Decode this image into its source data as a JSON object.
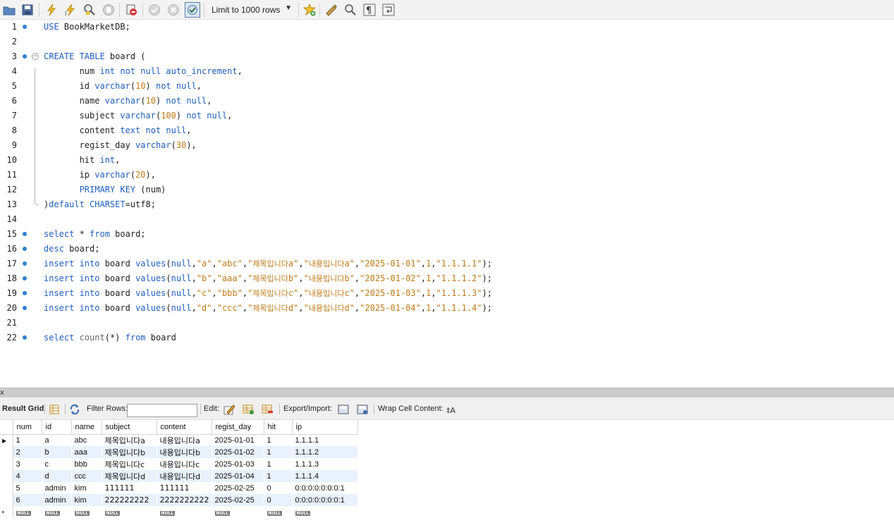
{
  "toolbar": {
    "limit_label": "Limit to 1000 rows",
    "icons": [
      "open-folder-icon",
      "save-icon",
      "execute-icon",
      "execute-current-icon",
      "explain-icon",
      "stop-icon",
      "toggle-error-stop-icon",
      "commit-icon",
      "rollback-icon",
      "autocommit-icon",
      "limit-rows-select",
      "add-snippet-icon",
      "beautify-icon",
      "find-icon",
      "invisible-chars-icon",
      "wrap-icon"
    ]
  },
  "editor": {
    "lines": [
      {
        "n": "1",
        "marker": "dot",
        "html": "<span class='kw'>USE</span> BookMarketDB;"
      },
      {
        "n": "2",
        "marker": "",
        "html": ""
      },
      {
        "n": "3",
        "marker": "dot-fold",
        "html": "<span class='kw'>CREATE TABLE</span> board ("
      },
      {
        "n": "4",
        "marker": "",
        "html": "       num <span class='kw'>int not null auto_increment</span>,"
      },
      {
        "n": "5",
        "marker": "",
        "html": "       id <span class='kw'>varchar</span>(<span class='num'>10</span>) <span class='kw'>not null</span>,"
      },
      {
        "n": "6",
        "marker": "",
        "html": "       name <span class='kw'>varchar</span>(<span class='num'>10</span>) <span class='kw'>not null</span>,"
      },
      {
        "n": "7",
        "marker": "",
        "html": "       subject <span class='kw'>varchar</span>(<span class='num'>100</span>) <span class='kw'>not null</span>,"
      },
      {
        "n": "8",
        "marker": "",
        "html": "       content <span class='kw'>text not null</span>,"
      },
      {
        "n": "9",
        "marker": "",
        "html": "       regist_day <span class='kw'>varchar</span>(<span class='num'>30</span>),"
      },
      {
        "n": "10",
        "marker": "",
        "html": "       hit <span class='kw'>int</span>,"
      },
      {
        "n": "11",
        "marker": "",
        "html": "       ip <span class='kw'>varchar</span>(<span class='num'>20</span>),"
      },
      {
        "n": "12",
        "marker": "",
        "html": "       <span class='kw'>PRIMARY KEY</span> (num)"
      },
      {
        "n": "13",
        "marker": "",
        "html": ")<span class='kw'>default CHARSET</span>=utf8;"
      },
      {
        "n": "14",
        "marker": "",
        "html": ""
      },
      {
        "n": "15",
        "marker": "dot",
        "html": "<span class='kw'>select</span> * <span class='kw'>from</span> board;"
      },
      {
        "n": "16",
        "marker": "dot",
        "html": "<span class='kw'>desc</span> board;"
      },
      {
        "n": "17",
        "marker": "dot",
        "html": "<span class='kw'>insert into</span> board <span class='kw'>values</span>(<span class='kw'>null</span>,<span class='str'>\"a\"</span>,<span class='str'>\"abc\"</span>,<span class='str'>\"<span class='ko'>제목입니다</span>a\"</span>,<span class='str'>\"<span class='ko'>내용입니다</span>a\"</span>,<span class='str'>\"2025-01-01\"</span>,<span class='num'>1</span>,<span class='str'>\"1.1.1.1\"</span>);"
      },
      {
        "n": "18",
        "marker": "dot",
        "html": "<span class='kw'>insert into</span> board <span class='kw'>values</span>(<span class='kw'>null</span>,<span class='str'>\"b\"</span>,<span class='str'>\"aaa\"</span>,<span class='str'>\"<span class='ko'>제목입니다</span>b\"</span>,<span class='str'>\"<span class='ko'>내용입니다</span>b\"</span>,<span class='str'>\"2025-01-02\"</span>,<span class='num'>1</span>,<span class='str'>\"1.1.1.2\"</span>);"
      },
      {
        "n": "19",
        "marker": "dot",
        "html": "<span class='kw'>insert into</span> board <span class='kw'>values</span>(<span class='kw'>null</span>,<span class='str'>\"c\"</span>,<span class='str'>\"bbb\"</span>,<span class='str'>\"<span class='ko'>제목입니다</span>c\"</span>,<span class='str'>\"<span class='ko'>내용입니다</span>c\"</span>,<span class='str'>\"2025-01-03\"</span>,<span class='num'>1</span>,<span class='str'>\"1.1.1.3\"</span>);"
      },
      {
        "n": "20",
        "marker": "dot",
        "html": "<span class='kw'>insert into</span> board <span class='kw'>values</span>(<span class='kw'>null</span>,<span class='str'>\"d\"</span>,<span class='str'>\"ccc\"</span>,<span class='str'>\"<span class='ko'>제목입니다</span>d\"</span>,<span class='str'>\"<span class='ko'>내용입니다</span>d\"</span>,<span class='str'>\"2025-01-04\"</span>,<span class='num'>1</span>,<span class='str'>\"1.1.1.4\"</span>);"
      },
      {
        "n": "21",
        "marker": "",
        "html": ""
      },
      {
        "n": "22",
        "marker": "dot",
        "html": "<span class='kw'>select</span> <span class='fn'>count</span>(*) <span class='kw'>from</span> board"
      }
    ]
  },
  "splitter": {
    "close_label": "x"
  },
  "result_toolbar": {
    "result_grid_label": "Result Grid",
    "filter_label": "Filter Rows:",
    "filter_value": "",
    "edit_label": "Edit:",
    "export_label": "Export/Import:",
    "wrap_label": "Wrap Cell Content:"
  },
  "result_grid": {
    "columns": [
      "num",
      "id",
      "name",
      "subject",
      "content",
      "regist_day",
      "hit",
      "ip"
    ],
    "rows": [
      [
        "1",
        "a",
        "abc",
        "제목입니다a",
        "내용입니다a",
        "2025-01-01",
        "1",
        "1.1.1.1"
      ],
      [
        "2",
        "b",
        "aaa",
        "제목입니다b",
        "내용입니다b",
        "2025-01-02",
        "1",
        "1.1.1.2"
      ],
      [
        "3",
        "c",
        "bbb",
        "제목입니다c",
        "내용입니다c",
        "2025-01-03",
        "1",
        "1.1.1.3"
      ],
      [
        "4",
        "d",
        "ccc",
        "제목입니다d",
        "내용입니다d",
        "2025-01-04",
        "1",
        "1.1.1.4"
      ],
      [
        "5",
        "admin",
        "kim",
        "111111",
        "111111",
        "2025-02-25",
        "0",
        "0:0:0:0:0:0:0:1"
      ],
      [
        "6",
        "admin",
        "kim",
        "222222222",
        "2222222222",
        "2025-02-25",
        "0",
        "0:0:0:0:0:0:0:1"
      ]
    ],
    "null_label": "NULL",
    "new_row_marker": "*"
  }
}
